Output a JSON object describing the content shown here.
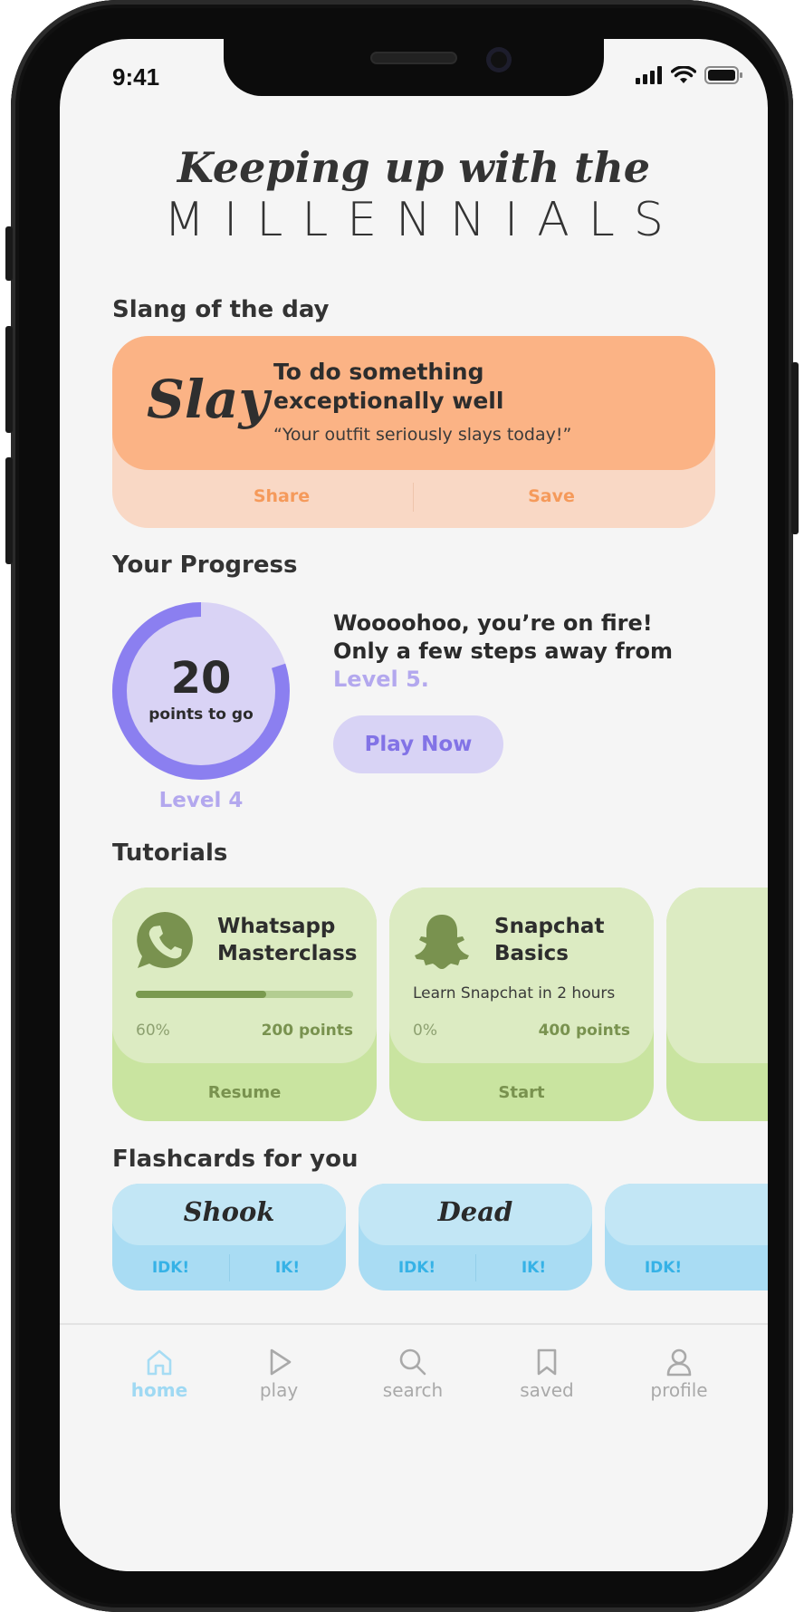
{
  "status_bar": {
    "time": "9:41"
  },
  "header": {
    "script_line": "Keeping up with the",
    "caps_line": "MILLENNIALS"
  },
  "slang": {
    "section_title": "Slang of the day",
    "word": "Slay",
    "definition": "To do something exceptionally well",
    "example": "“Your outfit seriously slays today!”",
    "share_label": "Share",
    "save_label": "Save",
    "colors": {
      "card": "#fbb385",
      "bottom": "#f9d8c5",
      "action": "#f59a5b"
    }
  },
  "progress": {
    "section_title": "Your Progress",
    "points_remaining": "20",
    "points_caption": "points to go",
    "ring_fill_fraction": 0.8,
    "level_label": "Level 4",
    "message": "Woooohoo, you’re on fire! Only a few steps away from",
    "next_level": "Level 5.",
    "play_label": "Play Now",
    "colors": {
      "ring": "#8b7ff0",
      "ring_bg": "#d9d3f5",
      "accent": "#b3a8ee"
    }
  },
  "tutorials": {
    "section_title": "Tutorials",
    "items": [
      {
        "icon": "whatsapp-icon",
        "title": "Whatsapp Masterclass",
        "description": "",
        "progress_fraction": 0.6,
        "percent": "60%",
        "points": "200 points",
        "action": "Resume"
      },
      {
        "icon": "snapchat-ghost-icon",
        "title": "Snapchat Basics",
        "description": "Learn Snapchat in 2 hours",
        "progress_fraction": 0,
        "percent": "0%",
        "points": "400 points",
        "action": "Start"
      }
    ],
    "colors": {
      "card": "#dcebc2",
      "bottom": "#c9e4a0",
      "accent": "#79924f"
    }
  },
  "flashcards": {
    "section_title": "Flashcards for you",
    "items": [
      {
        "word": "Shook",
        "left": "IDK!",
        "right": "IK!"
      },
      {
        "word": "Dead",
        "left": "IDK!",
        "right": "IK!"
      },
      {
        "word": "",
        "left": "IDK!",
        "right": ""
      }
    ],
    "colors": {
      "card": "#c2e6f5",
      "bottom": "#a9dcf3",
      "accent": "#36b2e6"
    }
  },
  "nav": {
    "active": "home",
    "items": [
      {
        "icon": "home-icon",
        "label": "home"
      },
      {
        "icon": "play-icon",
        "label": "play"
      },
      {
        "icon": "search-icon",
        "label": "search"
      },
      {
        "icon": "bookmark-icon",
        "label": "saved"
      },
      {
        "icon": "profile-icon",
        "label": "profile"
      }
    ]
  }
}
